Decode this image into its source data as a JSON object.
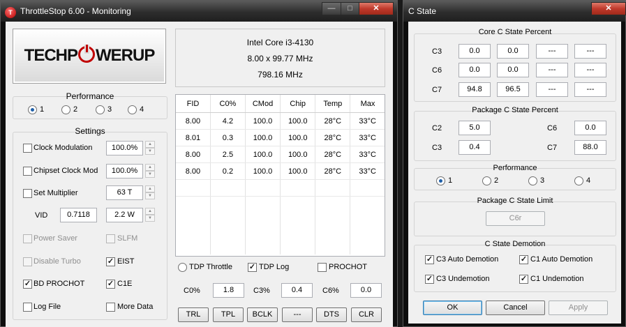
{
  "main_window": {
    "title": "ThrottleStop 6.00 - Monitoring",
    "app_icon": "T",
    "logo": {
      "left": "TECHP",
      "right": "WERUP"
    },
    "cpu": {
      "name": "Intel Core i3-4130",
      "multiplier": "8.00 x 99.77 MHz",
      "speed": "798.16 MHz"
    },
    "performance": {
      "title": "Performance",
      "options": [
        "1",
        "2",
        "3",
        "4"
      ],
      "selected": "1"
    },
    "settings": {
      "title": "Settings",
      "clock_modulation": {
        "label": "Clock Modulation",
        "value": "100.0%"
      },
      "chipset_clock_mod": {
        "label": "Chipset Clock Mod",
        "value": "100.0%"
      },
      "set_multiplier": {
        "label": "Set Multiplier",
        "value": "63 T"
      },
      "vid": {
        "label": "VID",
        "value": "0.7118",
        "power": "2.2 W"
      },
      "power_saver": "Power Saver",
      "slfm": "SLFM",
      "disable_turbo": "Disable Turbo",
      "eist": "EIST",
      "bd_prochot": "BD PROCHOT",
      "c1e": "C1E",
      "log_file": "Log File",
      "more_data": "More Data"
    },
    "table": {
      "headers": [
        "FID",
        "C0%",
        "CMod",
        "Chip",
        "Temp",
        "Max"
      ],
      "rows": [
        [
          "8.00",
          "4.2",
          "100.0",
          "100.0",
          "28°C",
          "33°C"
        ],
        [
          "8.01",
          "0.3",
          "100.0",
          "100.0",
          "28°C",
          "33°C"
        ],
        [
          "8.00",
          "2.5",
          "100.0",
          "100.0",
          "28°C",
          "33°C"
        ],
        [
          "8.00",
          "0.2",
          "100.0",
          "100.0",
          "28°C",
          "33°C"
        ]
      ]
    },
    "options": {
      "tdp_throttle": "TDP Throttle",
      "tdp_log": "TDP Log",
      "prochot": "PROCHOT"
    },
    "summary": {
      "c0_label": "C0%",
      "c0": "1.8",
      "c3_label": "C3%",
      "c3": "0.4",
      "c6_label": "C6%",
      "c6": "0.0"
    },
    "buttons": [
      "TRL",
      "TPL",
      "BCLK",
      "---",
      "DTS",
      "CLR"
    ]
  },
  "cstate_window": {
    "title": "C State",
    "core": {
      "title": "Core C State Percent",
      "rows": [
        {
          "label": "C3",
          "values": [
            "0.0",
            "0.0",
            "---",
            "---"
          ]
        },
        {
          "label": "C6",
          "values": [
            "0.0",
            "0.0",
            "---",
            "---"
          ]
        },
        {
          "label": "C7",
          "values": [
            "94.8",
            "96.5",
            "---",
            "---"
          ]
        }
      ]
    },
    "package": {
      "title": "Package C State Percent",
      "c2_label": "C2",
      "c2": "5.0",
      "c6_label": "C6",
      "c6": "0.0",
      "c3_label": "C3",
      "c3": "0.4",
      "c7_label": "C7",
      "c7": "88.0"
    },
    "performance": {
      "title": "Performance",
      "options": [
        "1",
        "2",
        "3",
        "4"
      ],
      "selected": "1"
    },
    "limit": {
      "title": "Package C State Limit",
      "value": "C6r"
    },
    "demotion": {
      "title": "C State Demotion",
      "c3_auto": "C3 Auto Demotion",
      "c1_auto": "C1 Auto Demotion",
      "c3_un": "C3 Undemotion",
      "c1_un": "C1 Undemotion"
    },
    "buttons": {
      "ok": "OK",
      "cancel": "Cancel",
      "apply": "Apply"
    }
  }
}
